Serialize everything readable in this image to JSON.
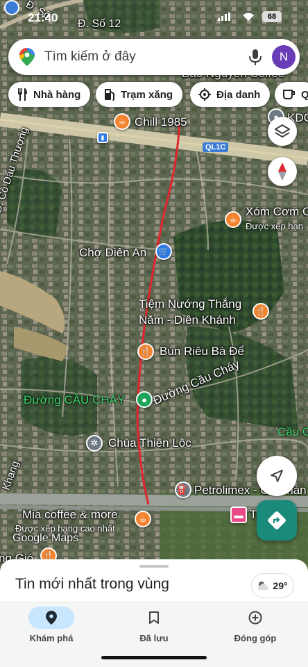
{
  "status_bar": {
    "time": "21:40",
    "battery": "68"
  },
  "search": {
    "placeholder": "Tìm kiếm ở đây",
    "avatar_letter": "N"
  },
  "chips": [
    {
      "label": "Nhà hàng",
      "icon": "fork-knife-icon"
    },
    {
      "label": "Trạm xăng",
      "icon": "gas-station-icon"
    },
    {
      "label": "Địa danh",
      "icon": "landmark-icon"
    },
    {
      "label": "Q",
      "icon": "cafe-icon"
    }
  ],
  "map": {
    "roads": {
      "so12": "Đ. Số 12",
      "so": "Đ. Số",
      "co_dau_thuong": "Đ. Cô Dấu Thượng",
      "cau_chay_green": "Đường CẦU CHÁY",
      "cau_chay": "Đường Cầu Cháy",
      "khang": "Khang",
      "ql1c": "QL1C"
    },
    "places": {
      "bao_nguyen": "Bảo Nguyên Coffee",
      "chill": "Chill 1985",
      "kdc": "KDC",
      "xom_com": "Xóm Cơm C",
      "xom_com_sub": "Được xếp hạn",
      "cho_dien_an": "Chợ Diên An",
      "tiem_nuong_1": "Tiệm Nướng Thắng",
      "tiem_nuong_2": "Năm - Diên Khánh",
      "bun_rieu": "Bún Riêu Bà Để",
      "chua": "Chùa Thiên Lộc",
      "cau_right": "Cầu C",
      "petrolimex": "Petrolimex - Cửa hàn",
      "mia": "Mia coffee & more",
      "mia_sub": "Được xếp hạng cao nhất",
      "t_bin": "T     Bin",
      "ng_gio": "ng Gió"
    },
    "attribution": "Google Maps"
  },
  "sheet": {
    "title": "Tin mới nhất trong vùng",
    "temperature": "29°"
  },
  "nav": [
    {
      "label": "Khám phá",
      "icon": "location-pin-icon",
      "active": true
    },
    {
      "label": "Đã lưu",
      "icon": "bookmark-icon",
      "active": false
    },
    {
      "label": "Đóng góp",
      "icon": "add-circle-icon",
      "active": false
    }
  ],
  "colors": {
    "route": "#e0262e",
    "accent": "#1a73e8",
    "directions": "#1a8a7a",
    "nav_active": "#c9e6ff"
  }
}
